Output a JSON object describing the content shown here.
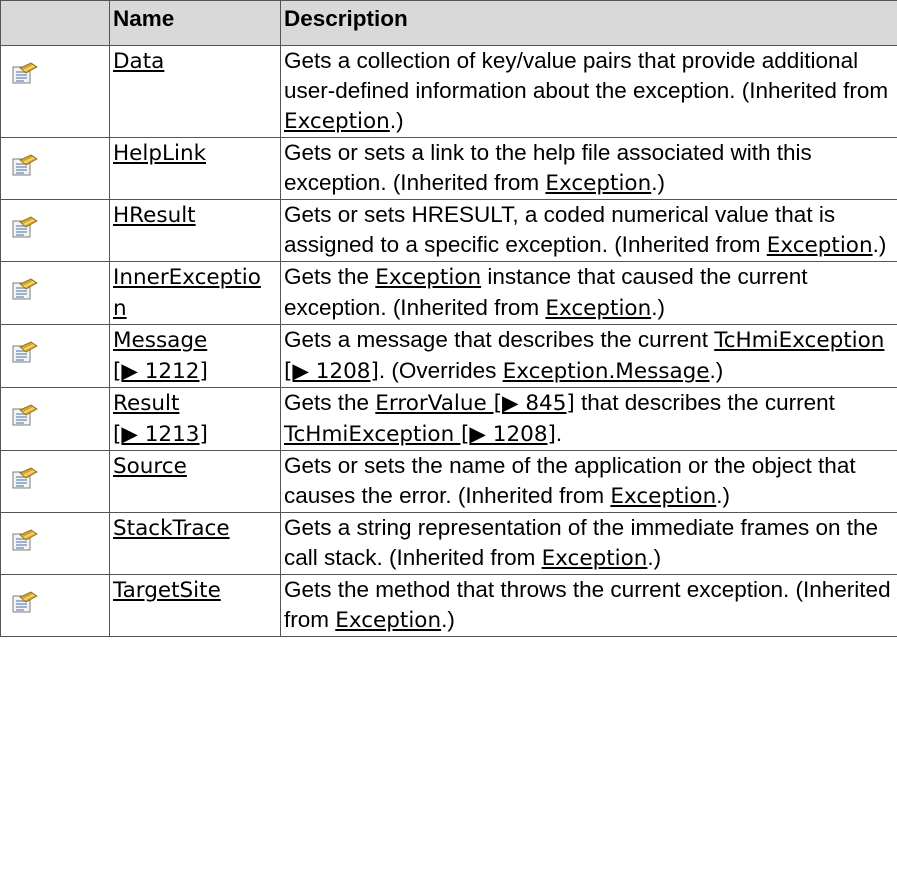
{
  "headers": {
    "icon": "",
    "name": "Name",
    "description": "Description"
  },
  "icon_name": "property-icon",
  "link_text": {
    "exception": "Exception",
    "tc_hmi_exception": "TcHmiException [▶ 1208]",
    "error_value": "ErrorValue [▶ 845]",
    "exception_message": "Exception.Message"
  },
  "rows": [
    {
      "name": "Data",
      "desc": "Gets a collection of key/value pairs that provide additional user-defined information about the exception. (Inherited from ",
      "desc_tail": ".)"
    },
    {
      "name": "HelpLink",
      "desc": "Gets or sets a link to the help file associated with this exception. (Inherited from ",
      "desc_tail": ".)"
    },
    {
      "name": "HResult",
      "desc": "Gets or sets HRESULT, a coded numerical value that is assigned to a specific exception. (Inherited from ",
      "desc_tail": ".)"
    },
    {
      "name": "InnerExceptio\nn",
      "desc_pre": "Gets the ",
      "desc_mid": " instance that caused the current exception. (Inherited from ",
      "desc_tail": ".)"
    },
    {
      "name": "Message [▶ 1212]",
      "desc_pre": "Gets a message that describes the current ",
      "desc_mid": ". (Overrides ",
      "desc_tail": ".)"
    },
    {
      "name": "Result [▶ 1213]",
      "desc_pre": "Gets the ",
      "desc_mid": " that describes the current ",
      "desc_tail": "."
    },
    {
      "name": "Source",
      "desc": "Gets or sets the name of the application or the object that causes the error. (Inherited from ",
      "desc_tail": ".)"
    },
    {
      "name": "StackTrace",
      "desc": "Gets a string representation of the immediate frames on the call stack. (Inherited from ",
      "desc_tail": ".)"
    },
    {
      "name": "TargetSite",
      "desc": "Gets the method that throws the current exception. (Inherited from ",
      "desc_tail": ".)"
    }
  ]
}
